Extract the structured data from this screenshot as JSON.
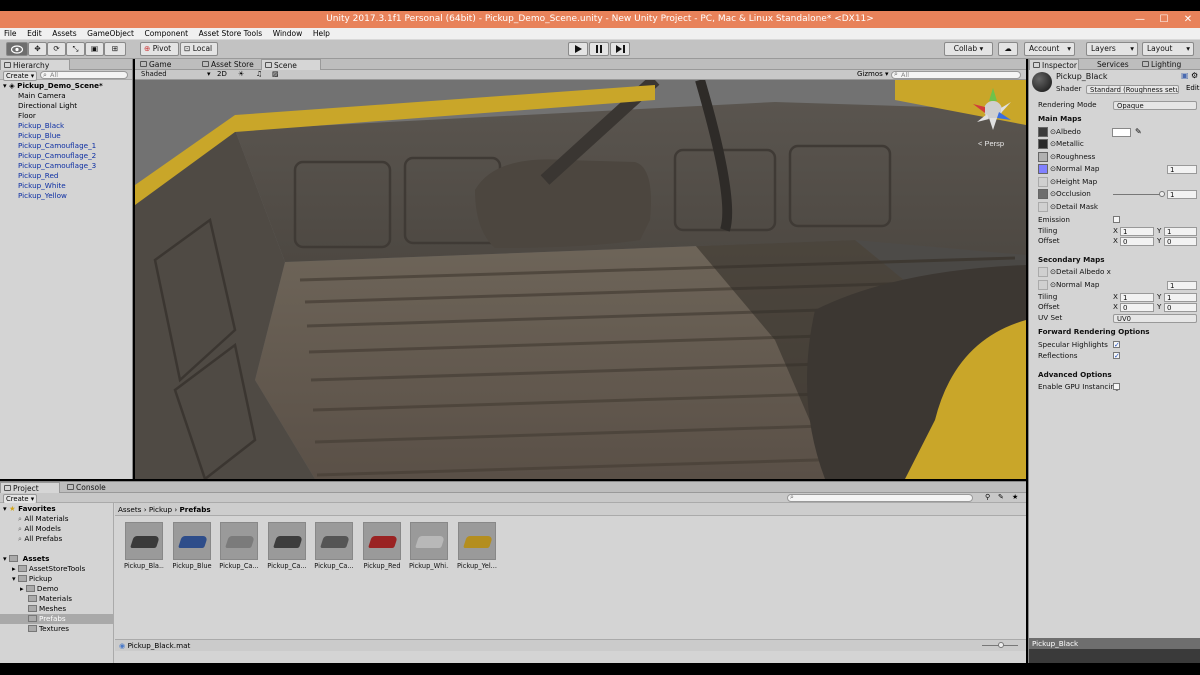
{
  "window": {
    "title": "Unity 2017.3.1f1 Personal (64bit) - Pickup_Demo_Scene.unity - New Unity Project - PC, Mac & Linux Standalone* <DX11>",
    "minimize": "—",
    "maximize": "☐",
    "close": "✕"
  },
  "menu": [
    "File",
    "Edit",
    "Assets",
    "GameObject",
    "Component",
    "Asset Store Tools",
    "Window",
    "Help"
  ],
  "toolbar": {
    "pivot": "Pivot",
    "local": "Local",
    "collab": "Collab ▾",
    "account": "Account",
    "layers": "Layers",
    "layout": "Layout"
  },
  "hierarchy": {
    "tab": "Hierarchy",
    "create": "Create ▾",
    "search_placeholder": "All",
    "scene_name": "Pickup_Demo_Scene*",
    "items": [
      {
        "label": "Main Camera",
        "prefab": false
      },
      {
        "label": "Directional Light",
        "prefab": false
      },
      {
        "label": "Floor",
        "prefab": false
      },
      {
        "label": "Pickup_Black",
        "prefab": true
      },
      {
        "label": "Pickup_Blue",
        "prefab": true
      },
      {
        "label": "Pickup_Camouflage_1",
        "prefab": true
      },
      {
        "label": "Pickup_Camouflage_2",
        "prefab": true
      },
      {
        "label": "Pickup_Camouflage_3",
        "prefab": true
      },
      {
        "label": "Pickup_Red",
        "prefab": true
      },
      {
        "label": "Pickup_White",
        "prefab": true
      },
      {
        "label": "Pickup_Yellow",
        "prefab": true
      }
    ]
  },
  "scene": {
    "tabs": [
      "Game",
      "Asset Store",
      "Scene"
    ],
    "shading_mode": "Shaded",
    "mode_2d": "2D",
    "gizmos": "Gizmos ▾",
    "search_placeholder": "All",
    "view_label": "< Persp"
  },
  "project": {
    "tabs": [
      "Project",
      "Console"
    ],
    "create": "Create ▾",
    "favorites_label": "Favorites",
    "favorites": [
      "All Materials",
      "All Models",
      "All Prefabs"
    ],
    "assets_label": "Assets",
    "tree": [
      {
        "label": "AssetStoreTools",
        "indent": 1
      },
      {
        "label": "Pickup",
        "indent": 1
      },
      {
        "label": "Demo",
        "indent": 2
      },
      {
        "label": "Materials",
        "indent": 2
      },
      {
        "label": "Meshes",
        "indent": 2
      },
      {
        "label": "Prefabs",
        "indent": 2,
        "selected": true
      },
      {
        "label": "Textures",
        "indent": 2
      }
    ],
    "breadcrumb": [
      "Assets",
      "Pickup",
      "Prefabs"
    ],
    "assets": [
      {
        "label": "Pickup_Bla...",
        "color": "#3a3a3a"
      },
      {
        "label": "Pickup_Blue",
        "color": "#2e4d8a"
      },
      {
        "label": "Pickup_Ca...",
        "color": "#7b7b7b"
      },
      {
        "label": "Pickup_Ca...",
        "color": "#3d3d3d"
      },
      {
        "label": "Pickup_Ca...",
        "color": "#555555"
      },
      {
        "label": "Pickup_Red",
        "color": "#9a2323"
      },
      {
        "label": "Pickup_Whi...",
        "color": "#b8b8b8"
      },
      {
        "label": "Pickup_Yel...",
        "color": "#b48e1f"
      }
    ],
    "status_file": "Pickup_Black.mat"
  },
  "inspector": {
    "tabs": [
      "Inspector",
      "Services",
      "Lighting"
    ],
    "material_name": "Pickup_Black",
    "shader_label": "Shader",
    "shader_value": "Standard (Roughness setup)",
    "rendering_mode_label": "Rendering Mode",
    "rendering_mode_value": "Opaque",
    "main_maps": "Main Maps",
    "albedo": "Albedo",
    "metallic": "Metallic",
    "roughness": "Roughness",
    "normal_map": "Normal Map",
    "normal_value": "1",
    "height_map": "Height Map",
    "occlusion": "Occlusion",
    "occlusion_value": "1",
    "occlusion_level": 1,
    "detail_mask": "Detail Mask",
    "emission": "Emission",
    "tiling": "Tiling",
    "offset": "Offset",
    "x_label": "X",
    "y_label": "Y",
    "tiling_x": "1",
    "tiling_y": "1",
    "offset_x": "0",
    "offset_y": "0",
    "secondary_maps": "Secondary Maps",
    "detail_albedo": "Detail Albedo x",
    "sec_normal_map": "Normal Map",
    "sec_normal_value": "1",
    "sec_tiling_x": "1",
    "sec_tiling_y": "1",
    "sec_offset_x": "0",
    "sec_offset_y": "0",
    "uv_set_label": "UV Set",
    "uv_set_value": "UV0",
    "forward_options": "Forward Rendering Options",
    "specular_highlights": "Specular Highlights",
    "reflections": "Reflections",
    "check_mark": "✓",
    "advanced_options": "Advanced Options",
    "gpu_instancing": "Enable GPU Instancing",
    "footer_label": "Pickup_Black"
  },
  "colors": {
    "titlebar": "#e8825a",
    "panel_bg": "#d4d4d4",
    "prefab_text": "#0d2fa3",
    "truck_yellow": "#c9a629"
  }
}
